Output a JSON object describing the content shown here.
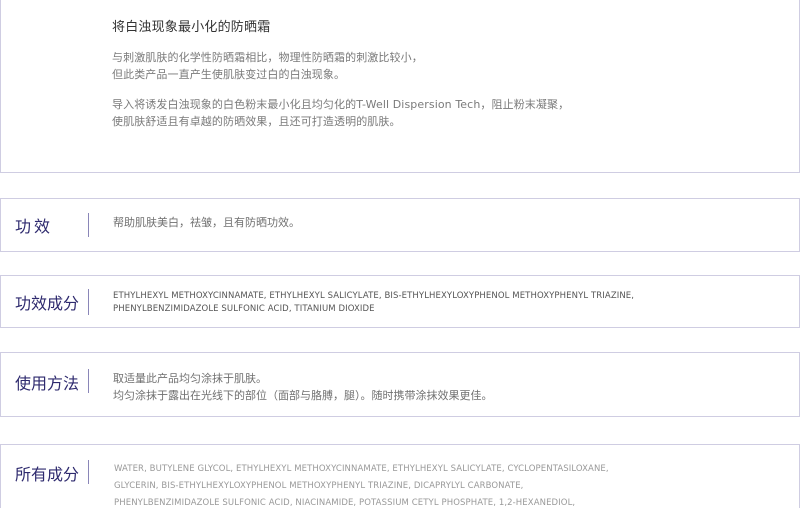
{
  "intro": {
    "title": "将白浊现象最小化的防晒霜",
    "para1_line1": "与刺激肌肤的化学性防晒霜相比，物理性防晒霜的刺激比较小，",
    "para1_line2": "但此类产品一直产生使肌肤变过白的白浊现象。",
    "para2_line1": "导入将诱发白浊现象的白色粉末最小化且均匀化的T-Well Dispersion Tech，阻止粉末凝聚，",
    "para2_line2": "使肌肤舒适且有卓越的防晒效果，且还可打造透明的肌肤。"
  },
  "sections": {
    "effect": {
      "title": "功效",
      "text": "帮助肌肤美白，祛皱，且有防晒功效。"
    },
    "active": {
      "title": "功效成分",
      "line1": "ETHYLHEXYL METHOXYCINNAMATE,  ETHYLHEXYL SALICYLATE,  BIS-ETHYLHEXYLOXYPHENOL METHOXYPHENYL TRIAZINE,",
      "line2": "PHENYLBENZIMIDAZOLE SULFONIC ACID, TITANIUM DIOXIDE"
    },
    "usage": {
      "title": "使用方法",
      "line1": "取适量此产品均匀涂抹于肌肤。",
      "line2": "均匀涂抹于露出在光线下的部位（面部与胳膊，腿）。随时携带涂抹效果更佳。"
    },
    "all": {
      "title": "所有成分",
      "line1": "WATER, BUTYLENE GLYCOL, ETHYLHEXYL METHOXYCINNAMATE, ETHYLHEXYL SALICYLATE, CYCLOPENTASILOXANE,",
      "line2": "GLYCERIN, BIS-ETHYLHEXYLOXYPHENOL METHOXYPHENYL TRIAZINE, DICAPRYLYL CARBONATE,",
      "line3": "PHENYLBENZIMIDAZOLE SULFONIC ACID, NIACINAMIDE, POTASSIUM CETYL PHOSPHATE, 1,2-HEXANEDIOL,"
    }
  },
  "colors": {
    "heading": "#2e2a6e",
    "border": "#cfcde2",
    "divider": "#8a86b8"
  }
}
